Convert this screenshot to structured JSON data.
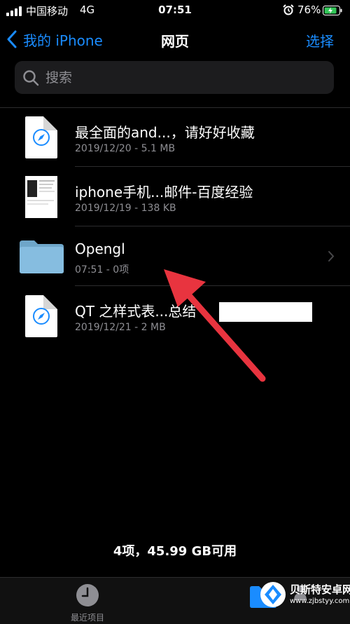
{
  "status_bar": {
    "carrier": "中国移动",
    "network": "4G",
    "time": "07:51",
    "battery_percent": "76%"
  },
  "nav": {
    "back_label": "我的 iPhone",
    "title": "网页",
    "select_label": "选择"
  },
  "search": {
    "placeholder": "搜索"
  },
  "files": [
    {
      "name": "最全面的and...，请好好收藏",
      "meta": "2019/12/20 - 5.1 MB",
      "icon": "safari-document-icon"
    },
    {
      "name": "iphone手机...邮件-百度经验",
      "meta": "2019/12/19 - 138 KB",
      "icon": "webpage-thumbnail"
    },
    {
      "name": "Opengl",
      "meta": "07:51 - 0项",
      "icon": "folder-icon"
    },
    {
      "name": "QT 之样式表...总结 -",
      "meta": "2019/12/21 - 2 MB",
      "icon": "safari-document-icon"
    }
  ],
  "storage_summary": "4项，45.99 GB可用",
  "tab_bar": {
    "recents_label": "最近项目"
  },
  "watermark": {
    "title": "贝斯特安卓网",
    "url": "www.zjbstyy.com"
  },
  "colors": {
    "accent": "#1a8cff",
    "annotation_arrow": "#e8343f",
    "folder": "#7fb3d5"
  }
}
